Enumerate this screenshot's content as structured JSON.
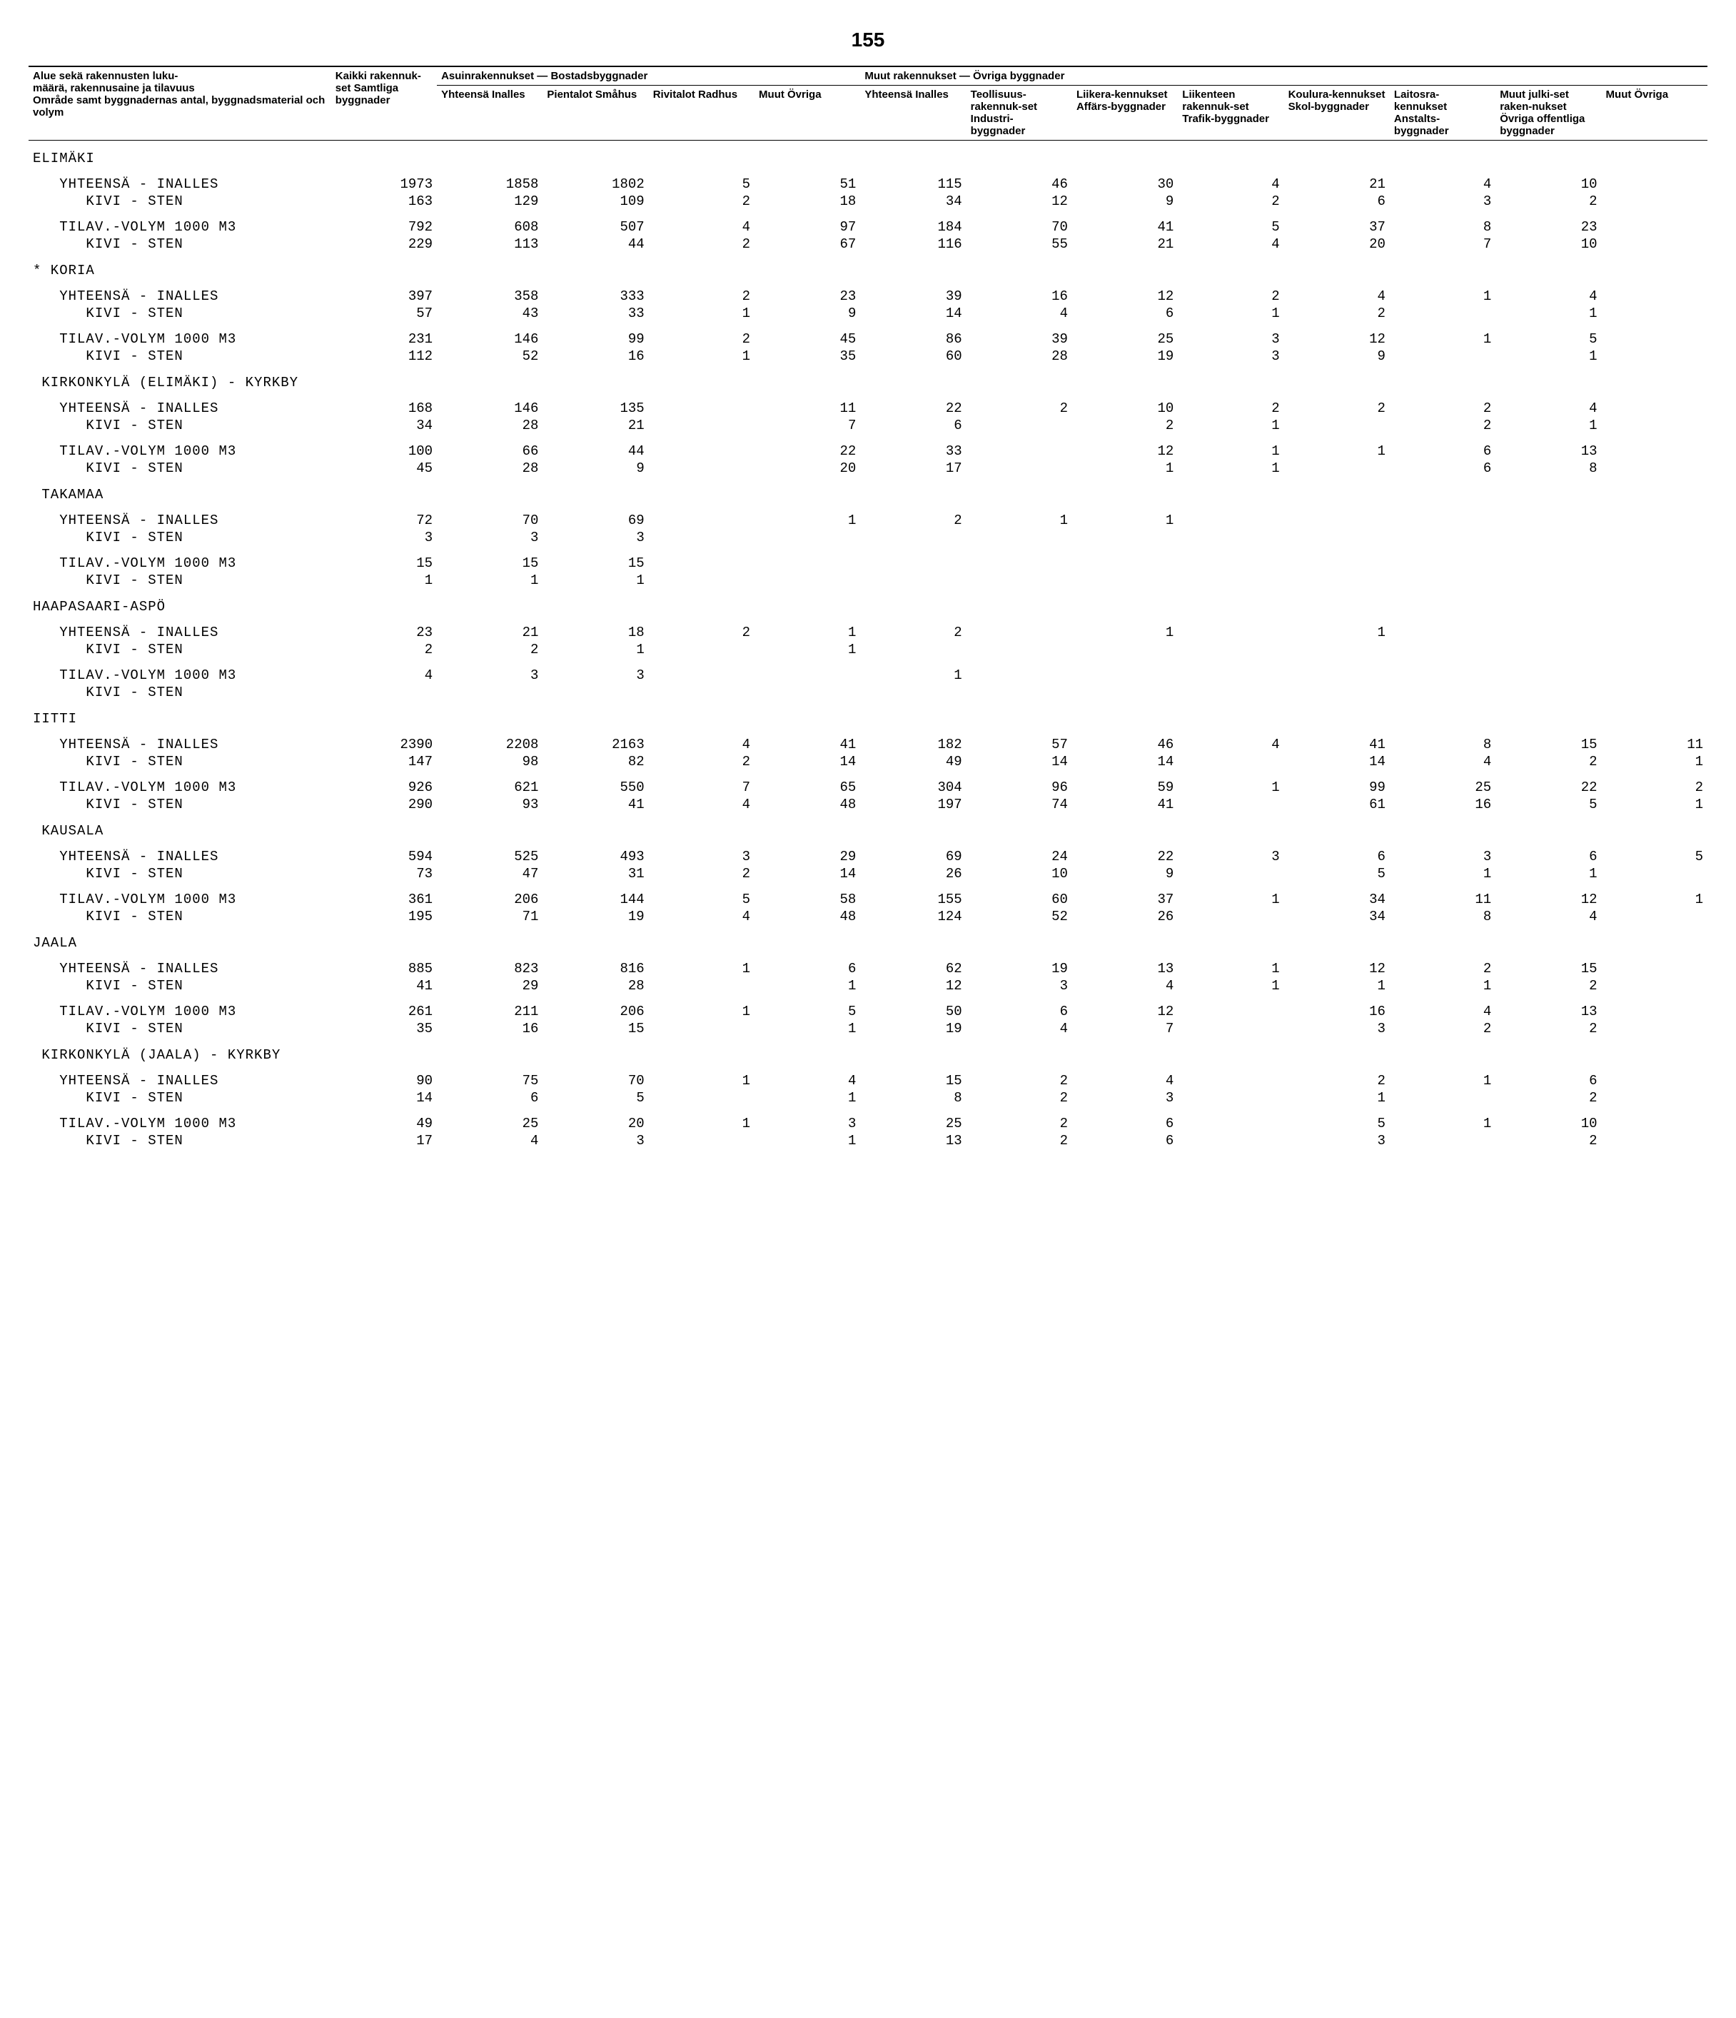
{
  "page_number": "155",
  "headers": {
    "col0_line1": "Alue sekä rakennusten luku-",
    "col0_line2": "määrä, rakennusaine ja tilavuus",
    "col0_line3": "Område samt byggnadernas antal, byggnadsmaterial och volym",
    "kaikki": "Kaikki rakennuk-set Samtliga byggnader",
    "asuin_group": "Asuinrakennukset — Bostadsbyggnader",
    "muut_group": "Muut rakennukset — Övriga byggnader",
    "c1": "Yhteensä Inalles",
    "c2": "Pientalot Småhus",
    "c3": "Rivitalot Radhus",
    "c4": "Muut Övriga",
    "c5": "Yhteensä Inalles",
    "c6": "Teollisuus-rakennuk-set Industri-byggnader",
    "c7": "Liikera-kennukset Affärs-byggnader",
    "c8": "Liikenteen rakennuk-set Trafik-byggnader",
    "c9": "Koulura-kennukset Skol-byggnader",
    "c10": "Laitosra-kennukset Anstalts-byggnader",
    "c11": "Muut julki-set raken-nukset Övriga offentliga byggnader",
    "c12": "Muut Övriga"
  },
  "rows": [
    {
      "type": "section",
      "label": "ELIMÄKI"
    },
    {
      "type": "pair",
      "l1": "   YHTEENSÄ - INALLES",
      "l2": "      KIVI - STEN",
      "v1": [
        "1973",
        "163"
      ],
      "v2": [
        "1858",
        "129"
      ],
      "v3": [
        "1802",
        "109"
      ],
      "v4": [
        "5",
        "2"
      ],
      "v5": [
        "51",
        "18"
      ],
      "v6": [
        "115",
        "34"
      ],
      "v7": [
        "46",
        "12"
      ],
      "v8": [
        "30",
        "9"
      ],
      "v9": [
        "4",
        "2"
      ],
      "v10": [
        "21",
        "6"
      ],
      "v11": [
        "4",
        "3"
      ],
      "v12": [
        "10",
        "2"
      ],
      "v13": [
        "",
        ""
      ]
    },
    {
      "type": "pair",
      "l1": "   TILAV.-VOLYM 1000 M3",
      "l2": "      KIVI - STEN",
      "v1": [
        "792",
        "229"
      ],
      "v2": [
        "608",
        "113"
      ],
      "v3": [
        "507",
        "44"
      ],
      "v4": [
        "4",
        "2"
      ],
      "v5": [
        "97",
        "67"
      ],
      "v6": [
        "184",
        "116"
      ],
      "v7": [
        "70",
        "55"
      ],
      "v8": [
        "41",
        "21"
      ],
      "v9": [
        "5",
        "4"
      ],
      "v10": [
        "37",
        "20"
      ],
      "v11": [
        "8",
        "7"
      ],
      "v12": [
        "23",
        "10"
      ],
      "v13": [
        "",
        ""
      ]
    },
    {
      "type": "section",
      "label": "* KORIA"
    },
    {
      "type": "pair",
      "l1": "   YHTEENSÄ - INALLES",
      "l2": "      KIVI - STEN",
      "v1": [
        "397",
        "57"
      ],
      "v2": [
        "358",
        "43"
      ],
      "v3": [
        "333",
        "33"
      ],
      "v4": [
        "2",
        "1"
      ],
      "v5": [
        "23",
        "9"
      ],
      "v6": [
        "39",
        "14"
      ],
      "v7": [
        "16",
        "4"
      ],
      "v8": [
        "12",
        "6"
      ],
      "v9": [
        "2",
        "1"
      ],
      "v10": [
        "4",
        "2"
      ],
      "v11": [
        "1",
        ""
      ],
      "v12": [
        "4",
        "1"
      ],
      "v13": [
        "",
        ""
      ]
    },
    {
      "type": "pair",
      "l1": "   TILAV.-VOLYM 1000 M3",
      "l2": "      KIVI - STEN",
      "v1": [
        "231",
        "112"
      ],
      "v2": [
        "146",
        "52"
      ],
      "v3": [
        "99",
        "16"
      ],
      "v4": [
        "2",
        "1"
      ],
      "v5": [
        "45",
        "35"
      ],
      "v6": [
        "86",
        "60"
      ],
      "v7": [
        "39",
        "28"
      ],
      "v8": [
        "25",
        "19"
      ],
      "v9": [
        "3",
        "3"
      ],
      "v10": [
        "12",
        "9"
      ],
      "v11": [
        "1",
        ""
      ],
      "v12": [
        "5",
        "1"
      ],
      "v13": [
        "",
        ""
      ]
    },
    {
      "type": "section",
      "label": " KIRKONKYLÄ (ELIMÄKI) - KYRKBY"
    },
    {
      "type": "pair",
      "l1": "   YHTEENSÄ - INALLES",
      "l2": "      KIVI - STEN",
      "v1": [
        "168",
        "34"
      ],
      "v2": [
        "146",
        "28"
      ],
      "v3": [
        "135",
        "21"
      ],
      "v4": [
        "",
        ""
      ],
      "v5": [
        "11",
        "7"
      ],
      "v6": [
        "22",
        "6"
      ],
      "v7": [
        "2",
        ""
      ],
      "v8": [
        "10",
        "2"
      ],
      "v9": [
        "2",
        "1"
      ],
      "v10": [
        "2",
        ""
      ],
      "v11": [
        "2",
        "2"
      ],
      "v12": [
        "4",
        "1"
      ],
      "v13": [
        "",
        ""
      ]
    },
    {
      "type": "pair",
      "l1": "   TILAV.-VOLYM 1000 M3",
      "l2": "      KIVI - STEN",
      "v1": [
        "100",
        "45"
      ],
      "v2": [
        "66",
        "28"
      ],
      "v3": [
        "44",
        "9"
      ],
      "v4": [
        "",
        ""
      ],
      "v5": [
        "22",
        "20"
      ],
      "v6": [
        "33",
        "17"
      ],
      "v7": [
        "",
        ""
      ],
      "v8": [
        "12",
        "1"
      ],
      "v9": [
        "1",
        "1"
      ],
      "v10": [
        "1",
        ""
      ],
      "v11": [
        "6",
        "6"
      ],
      "v12": [
        "13",
        "8"
      ],
      "v13": [
        "",
        ""
      ]
    },
    {
      "type": "section",
      "label": " TAKAMAA"
    },
    {
      "type": "pair",
      "l1": "   YHTEENSÄ - INALLES",
      "l2": "      KIVI - STEN",
      "v1": [
        "72",
        "3"
      ],
      "v2": [
        "70",
        "3"
      ],
      "v3": [
        "69",
        "3"
      ],
      "v4": [
        "",
        ""
      ],
      "v5": [
        "1",
        ""
      ],
      "v6": [
        "2",
        ""
      ],
      "v7": [
        "1",
        ""
      ],
      "v8": [
        "1",
        ""
      ],
      "v9": [
        "",
        ""
      ],
      "v10": [
        "",
        ""
      ],
      "v11": [
        "",
        ""
      ],
      "v12": [
        "",
        ""
      ],
      "v13": [
        "",
        ""
      ]
    },
    {
      "type": "pair",
      "l1": "   TILAV.-VOLYM 1000 M3",
      "l2": "      KIVI - STEN",
      "v1": [
        "15",
        "1"
      ],
      "v2": [
        "15",
        "1"
      ],
      "v3": [
        "15",
        "1"
      ],
      "v4": [
        "",
        ""
      ],
      "v5": [
        "",
        ""
      ],
      "v6": [
        "",
        ""
      ],
      "v7": [
        "",
        ""
      ],
      "v8": [
        "",
        ""
      ],
      "v9": [
        "",
        ""
      ],
      "v10": [
        "",
        ""
      ],
      "v11": [
        "",
        ""
      ],
      "v12": [
        "",
        ""
      ],
      "v13": [
        "",
        ""
      ]
    },
    {
      "type": "section",
      "label": "HAAPASAARI-ASPÖ"
    },
    {
      "type": "pair",
      "l1": "   YHTEENSÄ - INALLES",
      "l2": "      KIVI - STEN",
      "v1": [
        "23",
        "2"
      ],
      "v2": [
        "21",
        "2"
      ],
      "v3": [
        "18",
        "1"
      ],
      "v4": [
        "2",
        ""
      ],
      "v5": [
        "1",
        "1"
      ],
      "v6": [
        "2",
        ""
      ],
      "v7": [
        "",
        ""
      ],
      "v8": [
        "1",
        ""
      ],
      "v9": [
        "",
        ""
      ],
      "v10": [
        "1",
        ""
      ],
      "v11": [
        "",
        ""
      ],
      "v12": [
        "",
        ""
      ],
      "v13": [
        "",
        ""
      ]
    },
    {
      "type": "pair",
      "l1": "   TILAV.-VOLYM 1000 M3",
      "l2": "      KIVI - STEN",
      "v1": [
        "4",
        ""
      ],
      "v2": [
        "3",
        ""
      ],
      "v3": [
        "3",
        ""
      ],
      "v4": [
        "",
        ""
      ],
      "v5": [
        "",
        ""
      ],
      "v6": [
        "1",
        ""
      ],
      "v7": [
        "",
        ""
      ],
      "v8": [
        "",
        ""
      ],
      "v9": [
        "",
        ""
      ],
      "v10": [
        "",
        ""
      ],
      "v11": [
        "",
        ""
      ],
      "v12": [
        "",
        ""
      ],
      "v13": [
        "",
        ""
      ]
    },
    {
      "type": "section",
      "label": "IITTI"
    },
    {
      "type": "pair",
      "l1": "   YHTEENSÄ - INALLES",
      "l2": "      KIVI - STEN",
      "v1": [
        "2390",
        "147"
      ],
      "v2": [
        "2208",
        "98"
      ],
      "v3": [
        "2163",
        "82"
      ],
      "v4": [
        "4",
        "2"
      ],
      "v5": [
        "41",
        "14"
      ],
      "v6": [
        "182",
        "49"
      ],
      "v7": [
        "57",
        "14"
      ],
      "v8": [
        "46",
        "14"
      ],
      "v9": [
        "4",
        ""
      ],
      "v10": [
        "41",
        "14"
      ],
      "v11": [
        "8",
        "4"
      ],
      "v12": [
        "15",
        "2"
      ],
      "v13": [
        "11",
        "1"
      ]
    },
    {
      "type": "pair",
      "l1": "   TILAV.-VOLYM 1000 M3",
      "l2": "      KIVI - STEN",
      "v1": [
        "926",
        "290"
      ],
      "v2": [
        "621",
        "93"
      ],
      "v3": [
        "550",
        "41"
      ],
      "v4": [
        "7",
        "4"
      ],
      "v5": [
        "65",
        "48"
      ],
      "v6": [
        "304",
        "197"
      ],
      "v7": [
        "96",
        "74"
      ],
      "v8": [
        "59",
        "41"
      ],
      "v9": [
        "1",
        ""
      ],
      "v10": [
        "99",
        "61"
      ],
      "v11": [
        "25",
        "16"
      ],
      "v12": [
        "22",
        "5"
      ],
      "v13": [
        "2",
        "1"
      ]
    },
    {
      "type": "section",
      "label": " KAUSALA"
    },
    {
      "type": "pair",
      "l1": "   YHTEENSÄ - INALLES",
      "l2": "      KIVI - STEN",
      "v1": [
        "594",
        "73"
      ],
      "v2": [
        "525",
        "47"
      ],
      "v3": [
        "493",
        "31"
      ],
      "v4": [
        "3",
        "2"
      ],
      "v5": [
        "29",
        "14"
      ],
      "v6": [
        "69",
        "26"
      ],
      "v7": [
        "24",
        "10"
      ],
      "v8": [
        "22",
        "9"
      ],
      "v9": [
        "3",
        ""
      ],
      "v10": [
        "6",
        "5"
      ],
      "v11": [
        "3",
        "1"
      ],
      "v12": [
        "6",
        "1"
      ],
      "v13": [
        "5",
        ""
      ]
    },
    {
      "type": "pair",
      "l1": "   TILAV.-VOLYM 1000 M3",
      "l2": "      KIVI - STEN",
      "v1": [
        "361",
        "195"
      ],
      "v2": [
        "206",
        "71"
      ],
      "v3": [
        "144",
        "19"
      ],
      "v4": [
        "5",
        "4"
      ],
      "v5": [
        "58",
        "48"
      ],
      "v6": [
        "155",
        "124"
      ],
      "v7": [
        "60",
        "52"
      ],
      "v8": [
        "37",
        "26"
      ],
      "v9": [
        "1",
        ""
      ],
      "v10": [
        "34",
        "34"
      ],
      "v11": [
        "11",
        "8"
      ],
      "v12": [
        "12",
        "4"
      ],
      "v13": [
        "1",
        ""
      ]
    },
    {
      "type": "section",
      "label": "JAALA"
    },
    {
      "type": "pair",
      "l1": "   YHTEENSÄ - INALLES",
      "l2": "      KIVI - STEN",
      "v1": [
        "885",
        "41"
      ],
      "v2": [
        "823",
        "29"
      ],
      "v3": [
        "816",
        "28"
      ],
      "v4": [
        "1",
        ""
      ],
      "v5": [
        "6",
        "1"
      ],
      "v6": [
        "62",
        "12"
      ],
      "v7": [
        "19",
        "3"
      ],
      "v8": [
        "13",
        "4"
      ],
      "v9": [
        "1",
        "1"
      ],
      "v10": [
        "12",
        "1"
      ],
      "v11": [
        "2",
        "1"
      ],
      "v12": [
        "15",
        "2"
      ],
      "v13": [
        "",
        ""
      ]
    },
    {
      "type": "pair",
      "l1": "   TILAV.-VOLYM 1000 M3",
      "l2": "      KIVI - STEN",
      "v1": [
        "261",
        "35"
      ],
      "v2": [
        "211",
        "16"
      ],
      "v3": [
        "206",
        "15"
      ],
      "v4": [
        "1",
        ""
      ],
      "v5": [
        "5",
        "1"
      ],
      "v6": [
        "50",
        "19"
      ],
      "v7": [
        "6",
        "4"
      ],
      "v8": [
        "12",
        "7"
      ],
      "v9": [
        "",
        ""
      ],
      "v10": [
        "16",
        "3"
      ],
      "v11": [
        "4",
        "2"
      ],
      "v12": [
        "13",
        "2"
      ],
      "v13": [
        "",
        ""
      ]
    },
    {
      "type": "section",
      "label": " KIRKONKYLÄ (JAALA) - KYRKBY"
    },
    {
      "type": "pair",
      "l1": "   YHTEENSÄ - INALLES",
      "l2": "      KIVI - STEN",
      "v1": [
        "90",
        "14"
      ],
      "v2": [
        "75",
        "6"
      ],
      "v3": [
        "70",
        "5"
      ],
      "v4": [
        "1",
        ""
      ],
      "v5": [
        "4",
        "1"
      ],
      "v6": [
        "15",
        "8"
      ],
      "v7": [
        "2",
        "2"
      ],
      "v8": [
        "4",
        "3"
      ],
      "v9": [
        "",
        ""
      ],
      "v10": [
        "2",
        "1"
      ],
      "v11": [
        "1",
        ""
      ],
      "v12": [
        "6",
        "2"
      ],
      "v13": [
        "",
        ""
      ]
    },
    {
      "type": "pair",
      "l1": "   TILAV.-VOLYM 1000 M3",
      "l2": "      KIVI - STEN",
      "v1": [
        "49",
        "17"
      ],
      "v2": [
        "25",
        "4"
      ],
      "v3": [
        "20",
        "3"
      ],
      "v4": [
        "1",
        ""
      ],
      "v5": [
        "3",
        "1"
      ],
      "v6": [
        "25",
        "13"
      ],
      "v7": [
        "2",
        "2"
      ],
      "v8": [
        "6",
        "6"
      ],
      "v9": [
        "",
        ""
      ],
      "v10": [
        "5",
        "3"
      ],
      "v11": [
        "1",
        ""
      ],
      "v12": [
        "10",
        "2"
      ],
      "v13": [
        "",
        ""
      ]
    }
  ]
}
